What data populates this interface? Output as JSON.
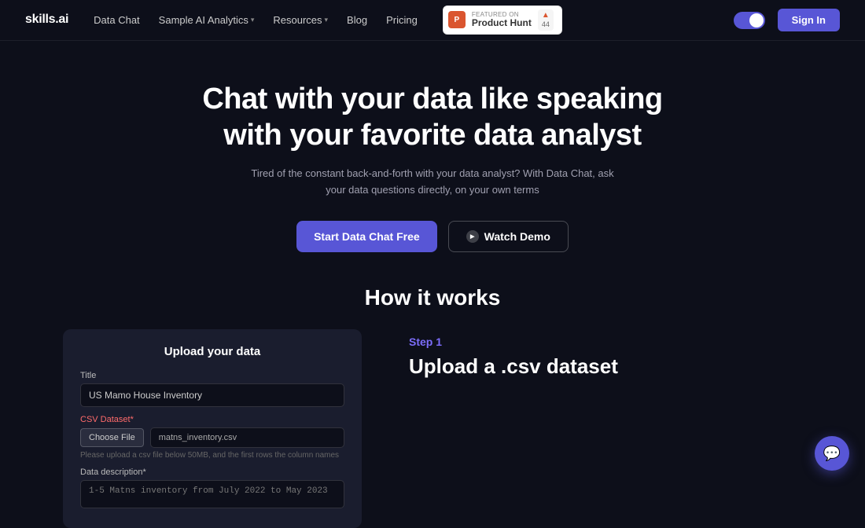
{
  "nav": {
    "logo": "skills.ai",
    "links": [
      {
        "label": "Data Chat",
        "hasDropdown": false
      },
      {
        "label": "Sample AI Analytics",
        "hasDropdown": true
      },
      {
        "label": "Resources",
        "hasDropdown": true
      },
      {
        "label": "Blog",
        "hasDropdown": false
      },
      {
        "label": "Pricing",
        "hasDropdown": false
      }
    ],
    "productHunt": {
      "topText": "FEATURED ON",
      "mainText": "Product Hunt",
      "upvoteCount": "44"
    },
    "signIn": "Sign In"
  },
  "hero": {
    "title": "Chat with your data like speaking with your favorite data analyst",
    "subtitle": "Tired of the constant back-and-forth with your data analyst? With Data Chat, ask your data questions directly, on your own terms",
    "primaryBtn": "Start Data Chat Free",
    "secondaryBtn": "Watch Demo"
  },
  "howSection": {
    "title": "How it works"
  },
  "uploadCard": {
    "title": "Upload your data",
    "titleLabel": "Title",
    "titlePlaceholder": "US Mamo House Inventory",
    "csvLabel": "CSV Dataset*",
    "chooseFile": "Choose File",
    "fileName": "matns_inventory.csv",
    "fileHint": "Please upload a csv file below 50MB, and the first rows the column names",
    "descLabel": "Data description*",
    "descPlaceholder": "1-5 Matns inventory from July 2022 to May 2023"
  },
  "stepInfo": {
    "stepLabel": "Step 1",
    "stepTitle": "Upload a .csv dataset"
  }
}
